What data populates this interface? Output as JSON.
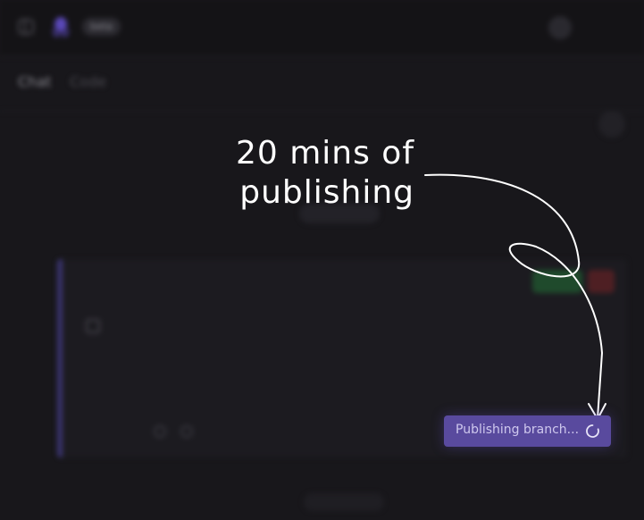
{
  "header": {
    "badge": "beta",
    "sidebar_icon": "sidebar-toggle-icon",
    "logo_icon": "octopus-logo"
  },
  "tabs": [
    {
      "label": "Chat",
      "active": true
    },
    {
      "label": "Code",
      "active": false
    }
  ],
  "annotation": {
    "line1": "20 mins of",
    "line2": "publishing"
  },
  "publish_button": {
    "label": "Publishing branch...",
    "icon": "spinner-icon",
    "color": "#594a9e"
  },
  "colors": {
    "background": "#18171b",
    "accent": "#594a9e",
    "annotation": "#ffffff"
  }
}
